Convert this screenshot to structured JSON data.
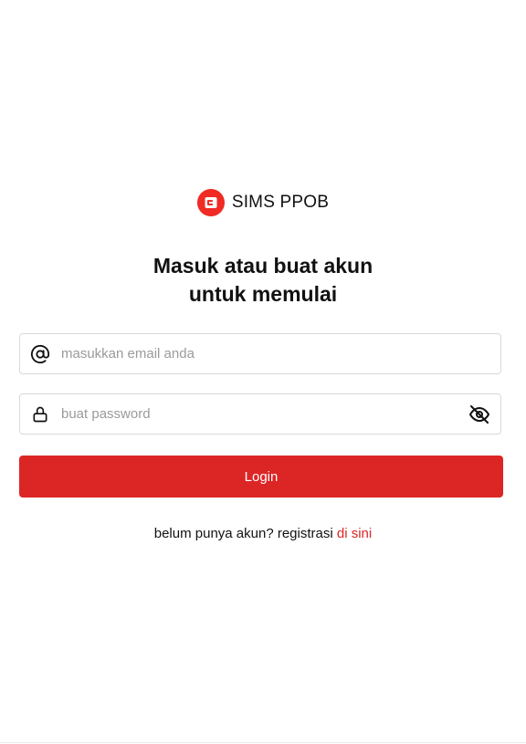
{
  "brand": {
    "name": "SIMS PPOB",
    "logo_color": "#ef2b24"
  },
  "heading": {
    "line1": "Masuk atau buat akun",
    "line2": "untuk memulai"
  },
  "email_field": {
    "placeholder": "masukkan email anda",
    "value": "",
    "icon": "at-sign-icon"
  },
  "password_field": {
    "placeholder": "buat password",
    "value": "",
    "icon": "lock-icon",
    "toggle_icon": "eye-off-icon"
  },
  "login_button": {
    "label": "Login",
    "color": "#dc2626"
  },
  "footer": {
    "text": "belum punya akun? registrasi ",
    "link_text": "di sini",
    "link_color": "#dc2626"
  }
}
